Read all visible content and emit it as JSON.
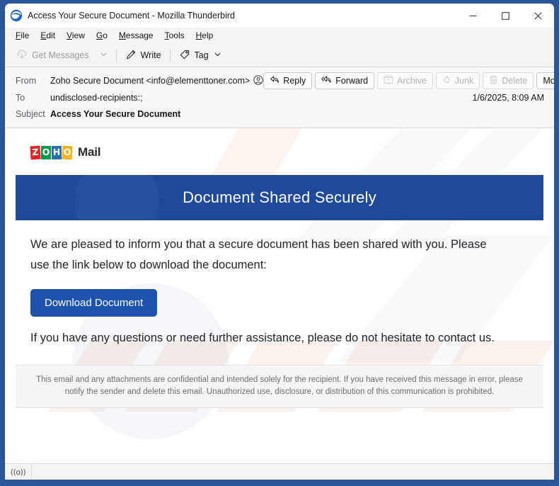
{
  "window": {
    "title": "Access Your Secure Document - Mozilla Thunderbird",
    "app_icon": "thunderbird-icon",
    "controls": {
      "minimize": "minimize-icon",
      "maximize": "maximize-icon",
      "close": "close-icon"
    },
    "frame_color": "#2a5699"
  },
  "menubar": {
    "items": [
      {
        "label": "File",
        "accel": "F"
      },
      {
        "label": "Edit",
        "accel": "E"
      },
      {
        "label": "View",
        "accel": "V"
      },
      {
        "label": "Go",
        "accel": "G"
      },
      {
        "label": "Message",
        "accel": "M"
      },
      {
        "label": "Tools",
        "accel": "T"
      },
      {
        "label": "Help",
        "accel": "H"
      }
    ]
  },
  "toolbar": {
    "get_messages": "Get Messages",
    "write": "Write",
    "tag": "Tag"
  },
  "message_header": {
    "from_label": "From",
    "from_value": "Zoho Secure Document <info@elementtoner.com>",
    "to_label": "To",
    "to_value": "undisclosed-recipients:;",
    "subject_label": "Subject",
    "subject_value": "Access Your Secure Document",
    "date": "1/6/2025, 8:09 AM",
    "actions": [
      {
        "label": "Reply",
        "icon": "reply-icon",
        "disabled": false
      },
      {
        "label": "Forward",
        "icon": "forward-icon",
        "disabled": false
      },
      {
        "label": "Archive",
        "icon": "archive-box-icon",
        "disabled": true
      },
      {
        "label": "Junk",
        "icon": "junk-flame-icon",
        "disabled": true
      },
      {
        "label": "Delete",
        "icon": "trash-icon",
        "disabled": true
      },
      {
        "label": "More",
        "icon": "chevron-down-icon",
        "disabled": false
      }
    ]
  },
  "mail": {
    "logo": {
      "tiles": [
        "Z",
        "O",
        "H",
        "O"
      ],
      "tile_colors": [
        "#e42527",
        "#089949",
        "#226db4",
        "#f9b21d"
      ],
      "word": "Mail"
    },
    "banner": {
      "title": "Document Shared Securely",
      "background": "#1f4a9c"
    },
    "paragraph_1": "We are pleased to inform you that a secure document has been shared with you. Please use the link below to download the document:",
    "cta_label": "Download Document",
    "cta_color": "#1e52ad",
    "paragraph_2": "If you have any questions or need further assistance, please do not hesitate to contact us.",
    "disclaimer": "This email and any attachments are confidential and intended solely for the recipient. If you have received this message in error, please notify the sender and delete this email. Unauthorized use, disclosure, or distribution of this communication is prohibited."
  },
  "statusbar": {
    "icon": "((o))",
    "text": ""
  }
}
